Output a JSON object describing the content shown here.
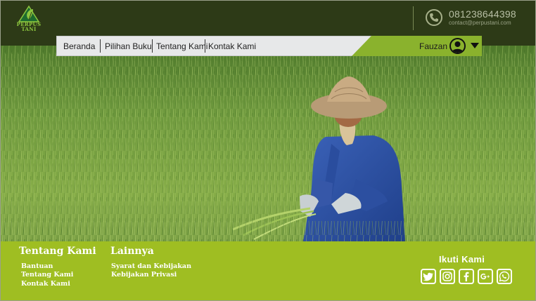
{
  "brand": {
    "logo_line1": "PERPUS",
    "logo_line2": "TANI",
    "green": "#8dc63f"
  },
  "contact": {
    "phone": "081238644398",
    "email": "contact@perpustani.com",
    "icon": "phone-icon"
  },
  "nav": {
    "items": [
      {
        "label": "Beranda"
      },
      {
        "label": "Pilihan Buku"
      },
      {
        "label": "Tentang Kami"
      },
      {
        "label": "Kontak Kami"
      }
    ],
    "user": {
      "name": "Fauzan",
      "icon": "user-avatar-icon",
      "menu_icon": "caret-down-icon"
    }
  },
  "footer": {
    "col1": {
      "title": "Tentang Kami",
      "links": [
        "Bantuan",
        "Tentang Kami",
        "Kontak Kami"
      ]
    },
    "col2": {
      "title": "Lainnya",
      "links": [
        "Syarat dan Kebijakan",
        "Kebijakan Privasi"
      ]
    },
    "social": {
      "title": "Ikuti Kami",
      "icons": [
        "twitter-icon",
        "instagram-icon",
        "facebook-icon",
        "google-plus-icon",
        "whatsapp-icon"
      ]
    }
  },
  "colors": {
    "header_bg": "#2d3a17",
    "nav_accent": "#8ab22d",
    "footer_bg": "#9fbe22"
  }
}
